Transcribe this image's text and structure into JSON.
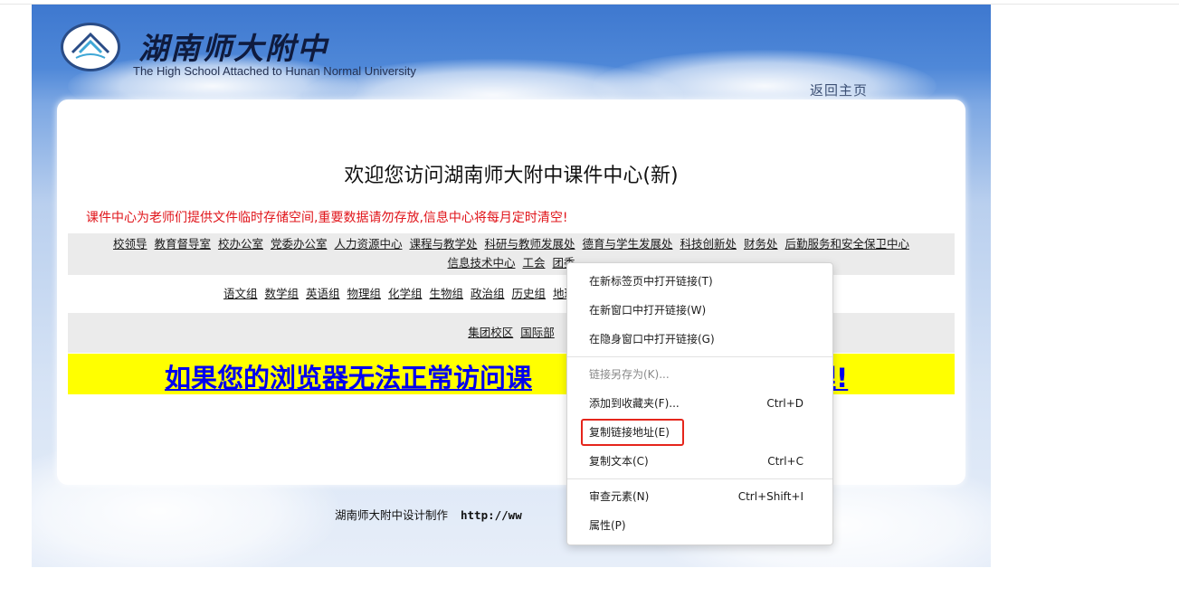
{
  "header": {
    "school_name": "湖南师大附中",
    "school_name_en": "The High School Attached to Hunan Normal University",
    "back_home": "返回主页"
  },
  "main": {
    "welcome": "欢迎您访问湖南师大附中课件中心(新)",
    "notice": "课件中心为老师们提供文件临时存储空间,重要数据请勿存放,信息中心将每月定时清空!",
    "departments": [
      "校领导",
      "教育督导室",
      "校办公室",
      "党委办公室",
      "人力资源中心",
      "课程与教学处",
      "科研与教师发展处",
      "德育与学生发展处",
      "科技创新处",
      "财务处",
      "后勤服务和安全保卫中心"
    ],
    "departments_row2": [
      "信息技术中心",
      "工会",
      "团委"
    ],
    "subject_groups": [
      "语文组",
      "数学组",
      "英语组",
      "物理组",
      "化学组",
      "生物组",
      "政治组",
      "历史组",
      "地理组"
    ],
    "campus_links": [
      "集团校区",
      "国际部"
    ],
    "browser_notice_left": "如果您的浏览器无法正常访问课",
    "browser_notice_right": "理!"
  },
  "footer": {
    "credit": "湖南师大附中设计制作",
    "url_partial": "http://ww"
  },
  "context_menu": {
    "items": [
      {
        "label": "在新标签页中打开链接(T)",
        "shortcut": "",
        "enabled": true
      },
      {
        "label": "在新窗口中打开链接(W)",
        "shortcut": "",
        "enabled": true
      },
      {
        "label": "在隐身窗口中打开链接(G)",
        "shortcut": "",
        "enabled": true
      },
      {
        "label": "链接另存为(K)...",
        "shortcut": "",
        "enabled": false
      },
      {
        "label": "添加到收藏夹(F)...",
        "shortcut": "Ctrl+D",
        "enabled": true
      },
      {
        "label": "复制链接地址(E)",
        "shortcut": "",
        "enabled": true,
        "highlighted": true
      },
      {
        "label": "复制文本(C)",
        "shortcut": "Ctrl+C",
        "enabled": true
      },
      {
        "label": "审查元素(N)",
        "shortcut": "Ctrl+Shift+I",
        "enabled": true
      },
      {
        "label": "属性(P)",
        "shortcut": "",
        "enabled": true
      }
    ]
  },
  "colors": {
    "notice_red": "#e0141a",
    "highlight_bar": "#ffff00",
    "link_blue": "#0000ee",
    "menu_highlight_border": "#e5251b"
  }
}
